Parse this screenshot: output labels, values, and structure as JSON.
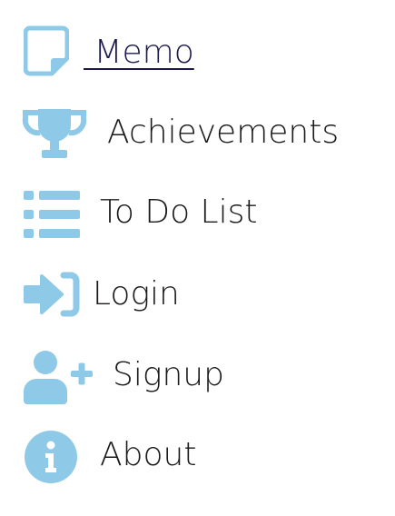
{
  "menu": {
    "accent_color": "#8ec9e8",
    "active_text_color": "#1b1a4e",
    "items": [
      {
        "label": " Memo",
        "icon": "sticky-note-icon",
        "active": true
      },
      {
        "label": "Achievements",
        "icon": "trophy-icon",
        "active": false
      },
      {
        "label": "To Do List",
        "icon": "list-icon",
        "active": false
      },
      {
        "label": "Login",
        "icon": "sign-in-icon",
        "active": false
      },
      {
        "label": "Signup",
        "icon": "user-plus-icon",
        "active": false
      },
      {
        "label": "About",
        "icon": "info-circle-icon",
        "active": false
      }
    ]
  }
}
